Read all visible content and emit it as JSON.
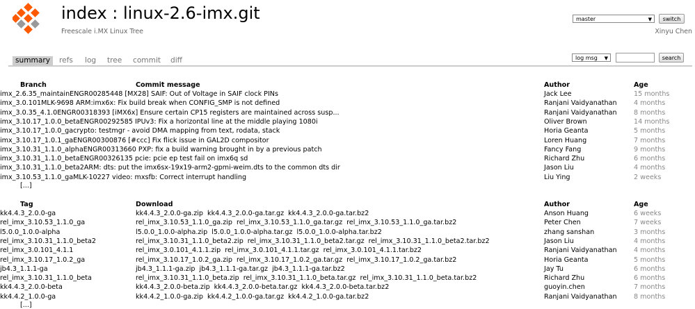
{
  "header": {
    "title": "index : linux-2.6-imx.git",
    "description": "Freescale i.MX Linux Tree",
    "owner": "Xinyu Chen",
    "branch_select": "master",
    "switch_label": "switch"
  },
  "tabs": [
    "summary",
    "refs",
    "log",
    "tree",
    "commit",
    "diff"
  ],
  "search": {
    "mode": "log msg",
    "button": "search"
  },
  "branches": {
    "headers": [
      "Branch",
      "Commit message",
      "Author",
      "Age"
    ],
    "rows": [
      [
        "imx_2.6.35_maintain",
        "ENGR00285448 [MX28] SAIF: Out of Voltage in SAIF clock PINs",
        "Jack Lee",
        "15 months"
      ],
      [
        "imx_3.0.101",
        "MLK-9698 ARM:imx6x: Fix build break when CONFIG_SMP is not defined",
        "Ranjani Vaidyanathan",
        "4 months"
      ],
      [
        "imx_3.0.35_4.1.0",
        "ENGR00318393 [iMX6x] Ensure certain CP15 registers are maintained across susp...",
        "Ranjani Vaidyanathan",
        "8 months"
      ],
      [
        "imx_3.10.17_1.0.0_beta",
        "ENGR00292585 IPUv3: Fix a horizontal line at the middle playing 1080i",
        "Oliver Brown",
        "14 months"
      ],
      [
        "imx_3.10.17_1.0.0_ga",
        "crypto: testmgr - avoid DMA mapping from text, rodata, stack",
        "Horia Geanta",
        "5 months"
      ],
      [
        "imx_3.10.17_1.0.1_ga",
        "ENGR00300876 [#ccc] Fix flick issue in GAL2D compositor",
        "Loren Huang",
        "7 months"
      ],
      [
        "imx_3.10.31_1.1.0_alpha",
        "ENGR00313660 PXP: fix a build warning brought in by a previous patch",
        "Fancy Fang",
        "9 months"
      ],
      [
        "imx_3.10.31_1.1.0_beta",
        "ENGR00326135 pcie: pcie ep test fail on imx6q sd",
        "Richard Zhu",
        "6 months"
      ],
      [
        "imx_3.10.31_1.1.0_beta2",
        "ARM: dts: put the imx6sx-19x19-arm2-gpmi-weim.dts to the common dts dir",
        "Jason Liu",
        "4 months"
      ],
      [
        "imx_3.10.53_1.1.0_ga",
        "MLK-10227 video: mxsfb: Correct interrupt handling",
        "Liu Ying",
        "2 weeks"
      ]
    ],
    "more": "[...]"
  },
  "tags": {
    "headers": [
      "Tag",
      "Download",
      "Author",
      "Age"
    ],
    "rows": [
      [
        "kk4.4.3_2.0.0-ga",
        [
          "kk4.4.3_2.0.0-ga.zip",
          "kk4.4.3_2.0.0-ga.tar.gz",
          "kk4.4.3_2.0.0-ga.tar.bz2"
        ],
        "Anson Huang",
        "6 weeks"
      ],
      [
        "rel_imx_3.10.53_1.1.0_ga",
        [
          "rel_imx_3.10.53_1.1.0_ga.zip",
          "rel_imx_3.10.53_1.1.0_ga.tar.gz",
          "rel_imx_3.10.53_1.1.0_ga.tar.bz2"
        ],
        "Peter Chen",
        "7 weeks"
      ],
      [
        "l5.0.0_1.0.0-alpha",
        [
          "l5.0.0_1.0.0-alpha.zip",
          "l5.0.0_1.0.0-alpha.tar.gz",
          "l5.0.0_1.0.0-alpha.tar.bz2"
        ],
        "zhang sanshan",
        "3 months"
      ],
      [
        "rel_imx_3.10.31_1.1.0_beta2",
        [
          "rel_imx_3.10.31_1.1.0_beta2.zip",
          "rel_imx_3.10.31_1.1.0_beta2.tar.gz",
          "rel_imx_3.10.31_1.1.0_beta2.tar.bz2"
        ],
        "Jason Liu",
        "4 months"
      ],
      [
        "rel_imx_3.0.101_4.1.1",
        [
          "rel_imx_3.0.101_4.1.1.zip",
          "rel_imx_3.0.101_4.1.1.tar.gz",
          "rel_imx_3.0.101_4.1.1.tar.bz2"
        ],
        "Ranjani Vaidyanathan",
        "4 months"
      ],
      [
        "rel_imx_3.10.17_1.0.2_ga",
        [
          "rel_imx_3.10.17_1.0.2_ga.zip",
          "rel_imx_3.10.17_1.0.2_ga.tar.gz",
          "rel_imx_3.10.17_1.0.2_ga.tar.bz2"
        ],
        "Horia Geanta",
        "5 months"
      ],
      [
        "jb4.3_1.1.1-ga",
        [
          "jb4.3_1.1.1-ga.zip",
          "jb4.3_1.1.1-ga.tar.gz",
          "jb4.3_1.1.1-ga.tar.bz2"
        ],
        "Jay Tu",
        "6 months"
      ],
      [
        "rel_imx_3.10.31_1.1.0_beta",
        [
          "rel_imx_3.10.31_1.1.0_beta.zip",
          "rel_imx_3.10.31_1.1.0_beta.tar.gz",
          "rel_imx_3.10.31_1.1.0_beta.tar.bz2"
        ],
        "Richard Zhu",
        "6 months"
      ],
      [
        "kk4.4.3_2.0.0-beta",
        [
          "kk4.4.3_2.0.0-beta.zip",
          "kk4.4.3_2.0.0-beta.tar.gz",
          "kk4.4.3_2.0.0-beta.tar.bz2"
        ],
        "guoyin.chen",
        "7 months"
      ],
      [
        "kk4.4.2_1.0.0-ga",
        [
          "kk4.4.2_1.0.0-ga.zip",
          "kk4.4.2_1.0.0-ga.tar.gz",
          "kk4.4.2_1.0.0-ga.tar.bz2"
        ],
        "Ranjani Vaidyanathan",
        "8 months"
      ]
    ],
    "more": "[...]"
  },
  "colors": {
    "logo_orange": "#ff5a00",
    "logo_gray": "#999999",
    "age_gray": "#888888"
  }
}
